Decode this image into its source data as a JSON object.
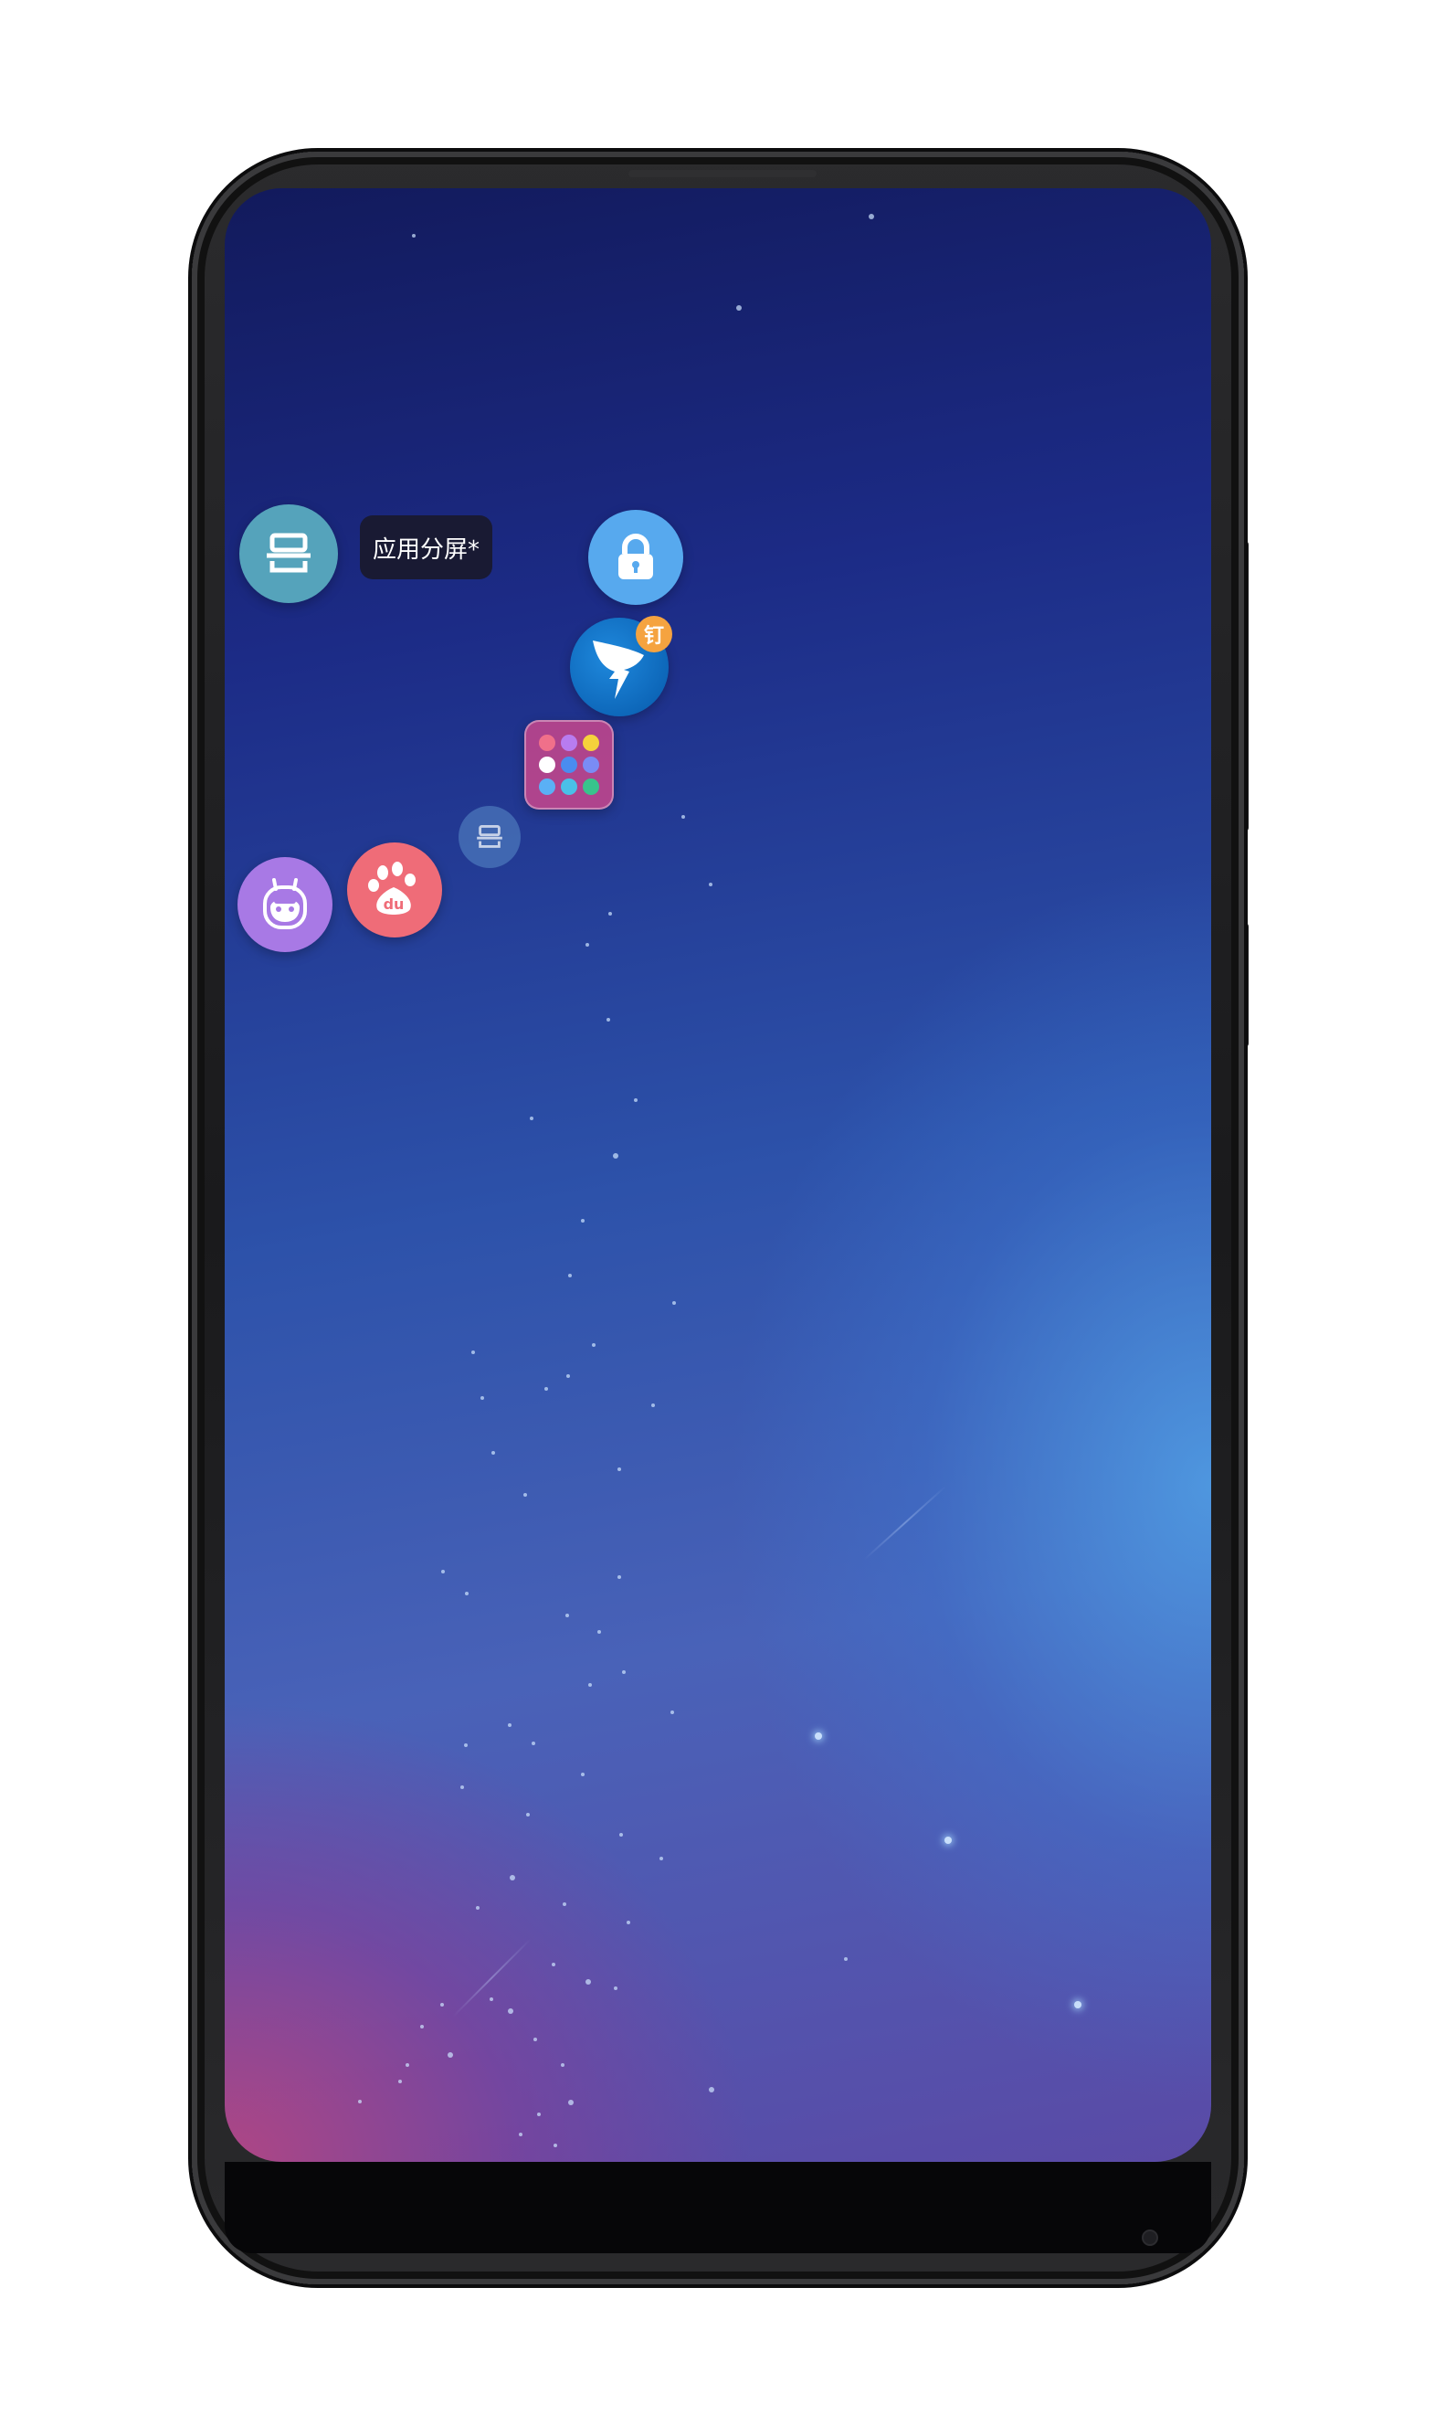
{
  "floating_menu": {
    "tooltip": "应用分屏*",
    "split_screen_icon": "split-screen-icon",
    "lock_icon": "lock-icon",
    "dingtalk": {
      "icon": "dingtalk-icon",
      "badge": "钉"
    },
    "folder_icon": "app-folder-icon",
    "faded_split_icon": "split-screen-icon",
    "baidu": {
      "icon": "baidu-paw-icon",
      "label": "du"
    },
    "robot_icon": "robot-assistant-icon"
  },
  "colors": {
    "split_ball": "#55a3bb",
    "lock_ball": "#57a9ee",
    "dingtalk_ball": "#0b63b5",
    "dingtalk_badge": "#f5a340",
    "folder": "#c8468c",
    "baidu_ball": "#ef6c78",
    "robot_ball": "#a879e5",
    "tooltip_bg": "#19192d"
  }
}
